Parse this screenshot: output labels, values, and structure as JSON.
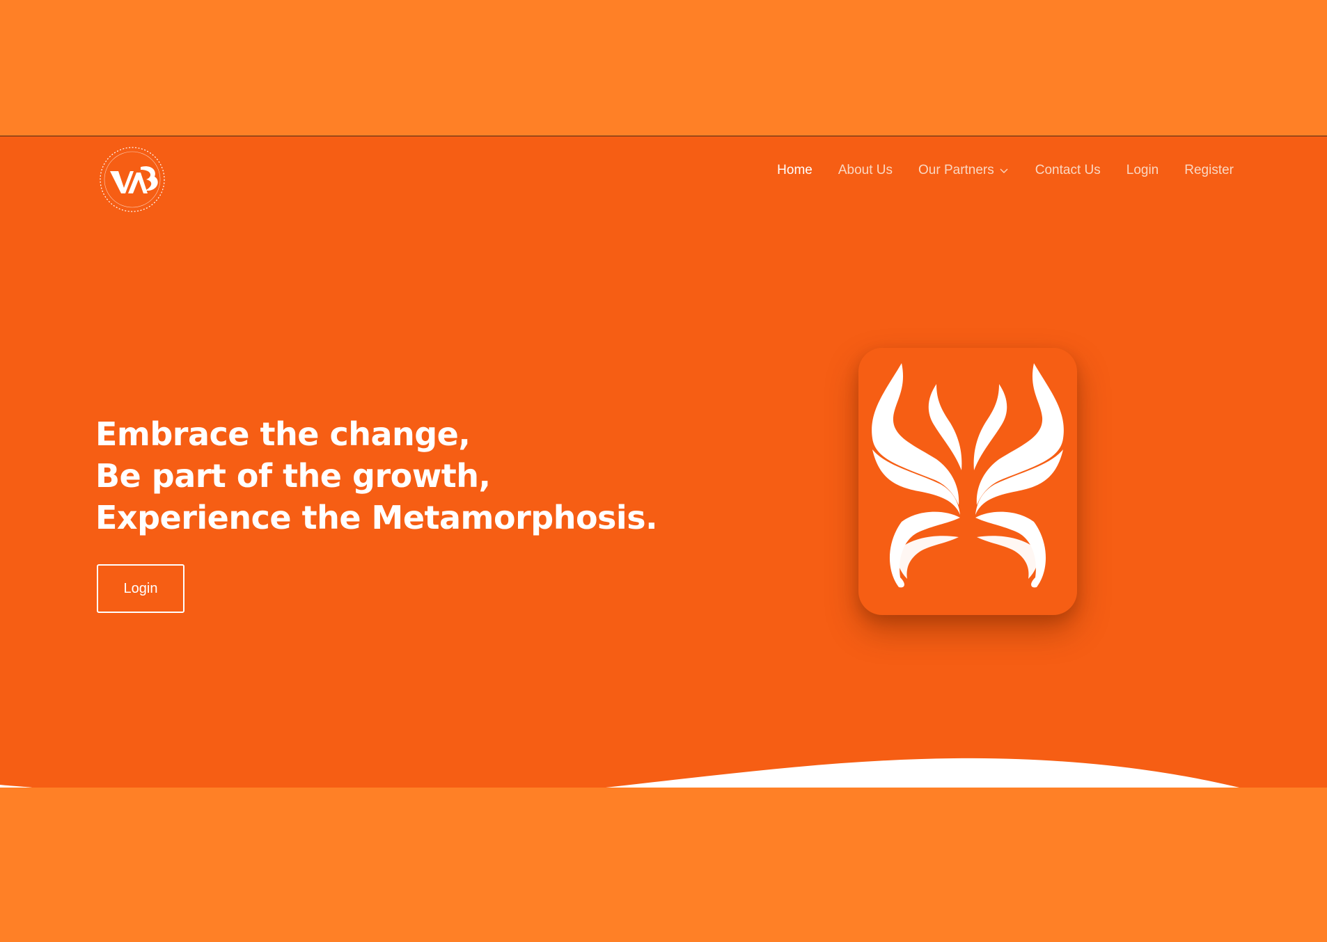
{
  "brand": {
    "logo_text": "VAB",
    "logo_ring_text": "UNITED ARCHITECTS OF THE PHILIPPINES · GRADUATE ARCHITECTS"
  },
  "nav": {
    "items": [
      {
        "label": "Home",
        "active": true
      },
      {
        "label": "About Us",
        "active": false
      },
      {
        "label": "Our Partners",
        "active": false,
        "has_dropdown": true
      },
      {
        "label": "Contact Us",
        "active": false
      },
      {
        "label": "Login",
        "active": false
      },
      {
        "label": "Register",
        "active": false
      }
    ]
  },
  "hero": {
    "lines": [
      "Embrace the change,",
      "Be part of the growth,",
      "Experience the Metamorphosis."
    ],
    "cta_label": "Login"
  },
  "colors": {
    "page_band": "#FF8026",
    "hero_bg": "#F65E14",
    "text_primary": "#FFFFFF",
    "nav_muted": "#FAD7C2"
  },
  "icons": {
    "dropdown": "chevron-down-icon",
    "emblem": "butterfly-emblem"
  }
}
